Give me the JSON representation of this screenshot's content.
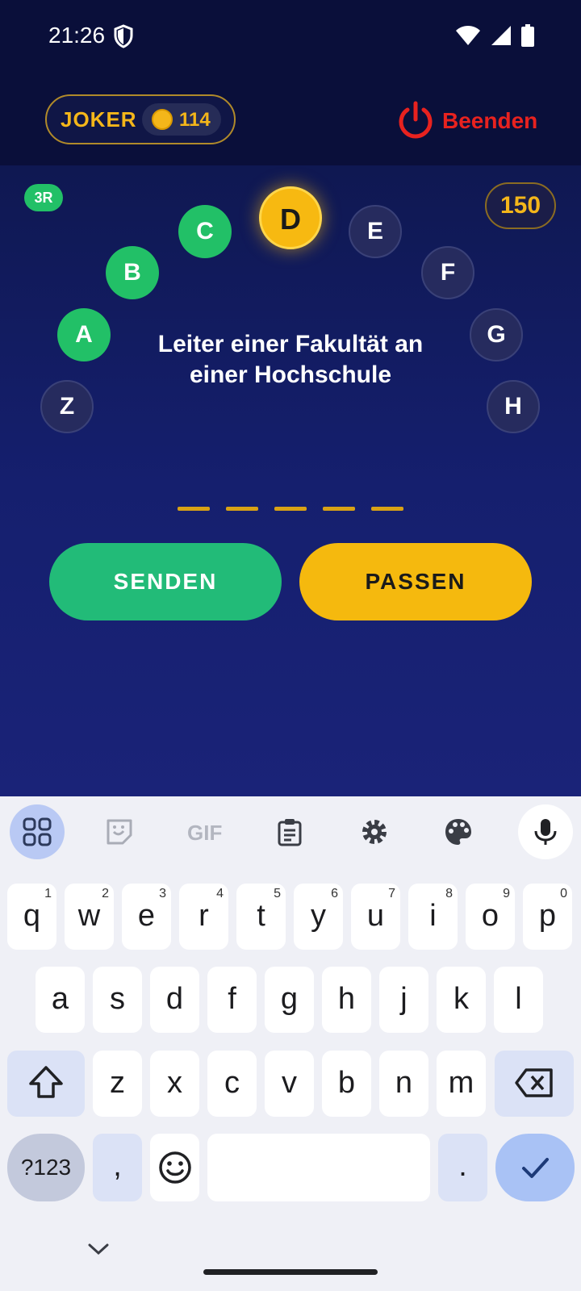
{
  "status_bar": {
    "time": "21:26"
  },
  "header": {
    "joker_label": "JOKER",
    "coins": "114",
    "end_label": "Beenden"
  },
  "game": {
    "round_badge": "3R",
    "score": "150",
    "letters": {
      "z": "Z",
      "a": "A",
      "b": "B",
      "c": "C",
      "d": "D",
      "e": "E",
      "f": "F",
      "g": "G",
      "h": "H"
    },
    "clue_line1": "Leiter einer Fakultät an",
    "clue_line2": "einer Hochschule",
    "answer_length": 5,
    "send_label": "SENDEN",
    "pass_label": "PASSEN"
  },
  "keyboard": {
    "toolbar_gif": "GIF",
    "row1": [
      {
        "key": "q",
        "hint": "1"
      },
      {
        "key": "w",
        "hint": "2"
      },
      {
        "key": "e",
        "hint": "3"
      },
      {
        "key": "r",
        "hint": "4"
      },
      {
        "key": "t",
        "hint": "5"
      },
      {
        "key": "y",
        "hint": "6"
      },
      {
        "key": "u",
        "hint": "7"
      },
      {
        "key": "i",
        "hint": "8"
      },
      {
        "key": "o",
        "hint": "9"
      },
      {
        "key": "p",
        "hint": "0"
      }
    ],
    "row2": [
      "a",
      "s",
      "d",
      "f",
      "g",
      "h",
      "j",
      "k",
      "l"
    ],
    "row3": [
      "z",
      "x",
      "c",
      "v",
      "b",
      "n",
      "m"
    ],
    "symbols_label": "?123",
    "comma": ",",
    "period": "."
  },
  "colors": {
    "done": "#22c067",
    "active": "#f7b911",
    "accent_gold": "#f4b61a",
    "end_red": "#e8221f"
  }
}
